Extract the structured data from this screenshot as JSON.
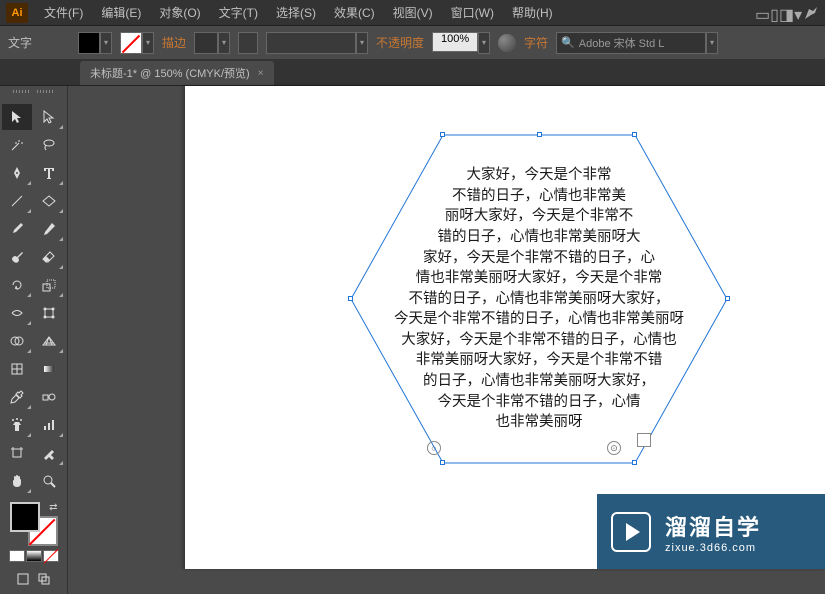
{
  "menu": {
    "logo": "Ai",
    "items": [
      "文件(F)",
      "编辑(E)",
      "对象(O)",
      "文字(T)",
      "选择(S)",
      "效果(C)",
      "视图(V)",
      "窗口(W)",
      "帮助(H)"
    ]
  },
  "options": {
    "tool_name": "文字",
    "stroke_label": "描边",
    "opacity_label": "不透明度",
    "opacity_value": "100%",
    "char_label": "字符",
    "font_search": "Adobe 宋体 Std L"
  },
  "tab": {
    "title": "未标题-1* @ 150% (CMYK/预览)",
    "close": "×"
  },
  "artboard": {
    "text": "大家好，今天是个非常\n不错的日子，心情也非常美\n丽呀大家好，今天是个非常不\n错的日子，心情也非常美丽呀大\n家好，今天是个非常不错的日子，心\n情也非常美丽呀大家好，今天是个非常\n不错的日子，心情也非常美丽呀大家好，\n今天是个非常不错的日子，心情也非常美丽呀\n大家好，今天是个非常不错的日子，心情也\n非常美丽呀大家好，今天是个非常不错\n的日子，心情也非常美丽呀大家好，\n今天是个非常不错的日子，心情\n也非常美丽呀"
  },
  "watermark": {
    "title": "溜溜自学",
    "url": "zixue.3d66.com"
  }
}
